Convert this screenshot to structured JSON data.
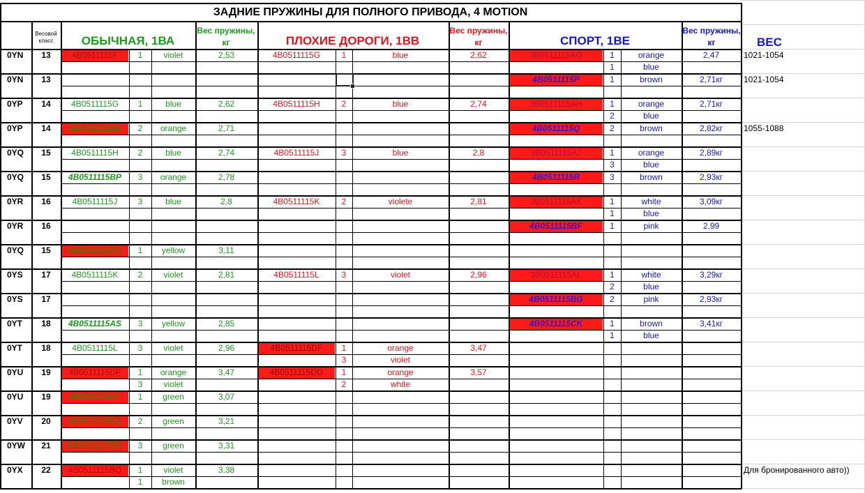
{
  "title": "ЗАДНИЕ ПРУЖИНЫ ДЛЯ ПОЛНОГО ПРИВОДА, 4 MOTION",
  "headers": {
    "weight_class": "Весовой класс",
    "normal": "ОБЫЧНАЯ, 1ВА",
    "bad_roads": "ПЛОХИЕ ДОРОГИ, 1ВВ",
    "sport": "СПОРТ, 1ВЕ",
    "spring_weight": "Вес пружины, кг",
    "weight": "ВЕС"
  },
  "colors": {
    "green": "#1c9a1c",
    "red": "#e0141c",
    "blue": "#1616c8",
    "cell_red": "#ff1a1a"
  },
  "rows": [
    {
      "code": "0YN",
      "cls": "13",
      "n": {
        "part": "4B0511115F",
        "marked": true,
        "style": "plain",
        "q": [
          "1"
        ],
        "c": [
          "violet"
        ],
        "w": "2,53"
      },
      "b": {
        "part": "4B0511115G",
        "marked": false,
        "q": [
          "1"
        ],
        "c": [
          "blue"
        ],
        "w": "2,62"
      },
      "s": {
        "part": "3B0511115AG",
        "marked": true,
        "style": "plain",
        "q": [
          "1",
          "1"
        ],
        "c": [
          "orange",
          "blue"
        ],
        "w": "2,47"
      },
      "weight": "1021-1054"
    },
    {
      "code": "0YN",
      "cls": "13",
      "n": null,
      "b": null,
      "s": {
        "part": "4B0511115P",
        "marked": true,
        "style": "bi",
        "q": [
          "1"
        ],
        "c": [
          "brown"
        ],
        "w": "2,71кг"
      },
      "weight": "1021-1054"
    },
    {
      "code": "0YP",
      "cls": "14",
      "n": {
        "part": "4B0511115G",
        "marked": false,
        "style": "plain",
        "q": [
          "1"
        ],
        "c": [
          "blue"
        ],
        "w": "2,62"
      },
      "b": {
        "part": "4B0511115H",
        "marked": false,
        "q": [
          "2"
        ],
        "c": [
          "blue"
        ],
        "w": "2,74"
      },
      "s": {
        "part": "3B0511115AH",
        "marked": true,
        "style": "plain",
        "q": [
          "1",
          "2"
        ],
        "c": [
          "orange",
          "blue"
        ],
        "w": "2,71кг"
      },
      "weight": ""
    },
    {
      "code": "0YP",
      "cls": "14",
      "n": {
        "part": "4B0511115BN",
        "marked": true,
        "style": "bi",
        "q": [
          "2"
        ],
        "c": [
          "orange"
        ],
        "w": "2,71"
      },
      "b": null,
      "s": {
        "part": "4B0511115Q",
        "marked": true,
        "style": "bi",
        "q": [
          "2"
        ],
        "c": [
          "brown"
        ],
        "w": "2,82кг"
      },
      "weight": "1055-1088"
    },
    {
      "code": "0YQ",
      "cls": "15",
      "n": {
        "part": "4B0511115H",
        "marked": false,
        "style": "plain",
        "q": [
          "2"
        ],
        "c": [
          "blue"
        ],
        "w": "2,74"
      },
      "b": {
        "part": "4B0511115J",
        "marked": false,
        "q": [
          "3"
        ],
        "c": [
          "blue"
        ],
        "w": "2,8"
      },
      "s": {
        "part": "3B0511115AJ",
        "marked": true,
        "style": "plain",
        "q": [
          "1",
          "3"
        ],
        "c": [
          "orange",
          "blue"
        ],
        "w": "2,89кг"
      },
      "weight": ""
    },
    {
      "code": "0YQ",
      "cls": "15",
      "n": {
        "part": "4B0511115BP",
        "marked": false,
        "style": "bi",
        "q": [
          "3"
        ],
        "c": [
          "orange"
        ],
        "w": "2,78"
      },
      "b": null,
      "s": {
        "part": "4B0511115R",
        "marked": true,
        "style": "bi",
        "q": [
          "3"
        ],
        "c": [
          "brown"
        ],
        "w": "2,93кг"
      },
      "weight": ""
    },
    {
      "code": "0YR",
      "cls": "16",
      "n": {
        "part": "4B0511115J",
        "marked": false,
        "style": "plain",
        "q": [
          "3"
        ],
        "c": [
          "blue"
        ],
        "w": "2,8"
      },
      "b": {
        "part": "4B0511115K",
        "marked": false,
        "q": [
          "2"
        ],
        "c": [
          "violete"
        ],
        "w": "2,81"
      },
      "s": {
        "part": "3B0511115AK",
        "marked": true,
        "style": "plain",
        "q": [
          "1",
          "1"
        ],
        "c": [
          "white",
          "blue"
        ],
        "w": "3,09кг"
      },
      "weight": ""
    },
    {
      "code": "0YR",
      "cls": "16",
      "n": null,
      "b": null,
      "s": {
        "part": "4B0511115BF",
        "marked": true,
        "style": "bi",
        "q": [
          "1"
        ],
        "c": [
          "pink"
        ],
        "w": "2,99"
      },
      "weight": ""
    },
    {
      "code": "0YQ",
      "cls": "15",
      "n": {
        "part": "4B0511115AQ",
        "marked": true,
        "style": "bi",
        "q": [
          "1"
        ],
        "c": [
          "yellow"
        ],
        "w": "3,11"
      },
      "b": null,
      "s": null,
      "weight": ""
    },
    {
      "code": "0YS",
      "cls": "17",
      "n": {
        "part": "4B0511115K",
        "marked": false,
        "style": "plain",
        "q": [
          "2"
        ],
        "c": [
          "violet"
        ],
        "w": "2,81"
      },
      "b": {
        "part": "4B0511115L",
        "marked": false,
        "q": [
          "3"
        ],
        "c": [
          "violet"
        ],
        "w": "2,96"
      },
      "s": {
        "part": "3B0511115AL",
        "marked": true,
        "style": "plain",
        "q": [
          "1",
          "2"
        ],
        "c": [
          "white",
          "blue"
        ],
        "w": "3,29кг"
      },
      "weight": ""
    },
    {
      "code": "0YS",
      "cls": "17",
      "n": null,
      "b": null,
      "s": {
        "part": "4B0511115BG",
        "marked": true,
        "style": "bi",
        "q": [
          "2"
        ],
        "c": [
          "pink"
        ],
        "w": "2,93кг"
      },
      "weight": ""
    },
    {
      "code": "0YT",
      "cls": "18",
      "n": {
        "part": "4B0511115AS",
        "marked": false,
        "style": "bi",
        "q": [
          "3"
        ],
        "c": [
          "yellow"
        ],
        "w": "2,85"
      },
      "b": null,
      "s": {
        "part": "4B0511115CK",
        "marked": true,
        "style": "bi",
        "q": [
          "1",
          "1"
        ],
        "c": [
          "brown",
          "blue"
        ],
        "w": "3,41кг"
      },
      "weight": ""
    },
    {
      "code": "0YT",
      "cls": "18",
      "n": {
        "part": "4B0511115L",
        "marked": false,
        "style": "plain",
        "q": [
          "3"
        ],
        "c": [
          "violet"
        ],
        "w": "2,96"
      },
      "b": {
        "part": "4B0511115DF",
        "marked": true,
        "q": [
          "1",
          "3"
        ],
        "c": [
          "orange",
          "violet"
        ],
        "w": "3,47"
      },
      "s": null,
      "weight": ""
    },
    {
      "code": "0YU",
      "cls": "19",
      "n": {
        "part": "4B0511115DF",
        "marked": true,
        "style": "plain",
        "q": [
          "1",
          "3"
        ],
        "c": [
          "orange",
          "violet"
        ],
        "w": "3,47"
      },
      "b": {
        "part": "4B0511115DG",
        "marked": true,
        "q": [
          "1",
          "2"
        ],
        "c": [
          "orange",
          "white"
        ],
        "w": "3,57"
      },
      "s": null,
      "weight": ""
    },
    {
      "code": "0YU",
      "cls": "19",
      "n": {
        "part": "4B0511115AT",
        "marked": true,
        "style": "bi",
        "q": [
          "1"
        ],
        "c": [
          "green"
        ],
        "w": "3,07"
      },
      "b": null,
      "s": null,
      "weight": ""
    },
    {
      "code": "0YV",
      "cls": "20",
      "n": {
        "part": "4B0511115BA",
        "marked": true,
        "style": "bi",
        "q": [
          "2"
        ],
        "c": [
          "green"
        ],
        "w": "3,21"
      },
      "b": null,
      "s": null,
      "weight": ""
    },
    {
      "code": "0YW",
      "cls": "21",
      "n": {
        "part": "4B0511115BB",
        "marked": true,
        "style": "bi",
        "q": [
          "3"
        ],
        "c": [
          "green"
        ],
        "w": "3,31"
      },
      "b": null,
      "s": null,
      "weight": ""
    },
    {
      "code": "0YX",
      "cls": "22",
      "n": {
        "part": "4B0511115BQ",
        "marked": true,
        "style": "plain",
        "q": [
          "1",
          "1"
        ],
        "c": [
          "violet",
          "brown"
        ],
        "w": "3,38"
      },
      "b": null,
      "s": null,
      "weight": "Для бронированного авто))"
    }
  ]
}
